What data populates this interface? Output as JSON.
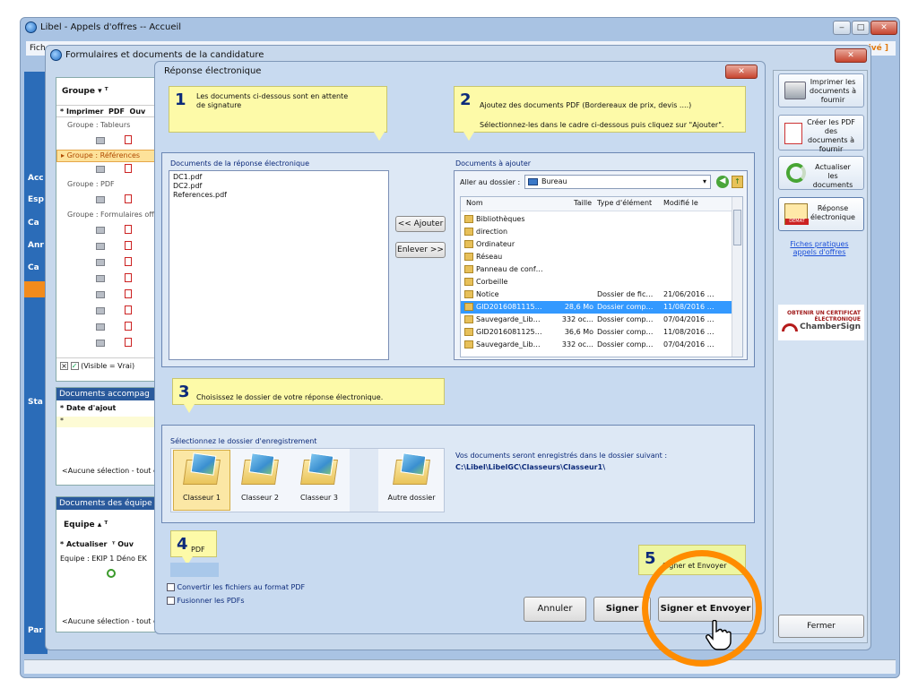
{
  "main_window": {
    "title": "Libel - Appels d'offres -- Accueil",
    "menu_first": "Fich",
    "right_tag": "ivé ]"
  },
  "app_controls": {
    "minimize": "‒",
    "maximize": "□",
    "close": "✕"
  },
  "left_nav": {
    "items": [
      "Acc",
      "Esp",
      "Ca",
      "Anr",
      "Ca",
      "Sta",
      "Par"
    ]
  },
  "candidature_window": {
    "title": "Formulaires et documents de la candidature",
    "groupe_header": "Groupe",
    "toolbar": {
      "imprimer": "Imprimer",
      "pdf": "PDF",
      "ouv": "Ouv"
    },
    "groups": [
      "Groupe : Tableurs",
      "Groupe : Références",
      "Groupe : PDF",
      "Groupe : Formulaires off"
    ],
    "filter_label": "(Visible = Vrai)",
    "docs_accomp": {
      "title": "Documents accompag",
      "date_col": "Date d'ajout",
      "empty": "<Aucune sélection - tout e"
    },
    "docs_equipe": {
      "title": "Documents des équipe",
      "equipe_header": "Equipe",
      "actualiser": "Actualiser",
      "ouv": "Ouv",
      "row": "Equipe : EKIP 1 Déno EK",
      "empty": "<Aucune sélection - tout e"
    },
    "sidebar": {
      "imprimer": "Imprimer les documents à fournir",
      "creer_pdf": "Créer les PDF des documents à fournir",
      "actualiser": "Actualiser les documents",
      "reponse": "Réponse électronique",
      "fiches": "Fiches pratiques appels d'offres",
      "chambersign_top": "OBTENIR UN CERTIFICAT ÉLECTRONIQUE",
      "chambersign_brand": "ChamberSign",
      "fermer": "Fermer",
      "demat": "DÉMAT"
    }
  },
  "dialog": {
    "title": "Réponse électronique",
    "close": "✕",
    "step1": {
      "num": "1",
      "text": "Les documents ci-dessous sont en attente de signature"
    },
    "step2": {
      "num": "2",
      "line1": "Ajoutez des documents PDF (Bordereaux de prix, devis ....)",
      "line2": "Sélectionnez-les dans le cadre  ci-dessous puis cliquez sur \"Ajouter\"."
    },
    "step3": {
      "num": "3",
      "text": "Choisissez le dossier de votre réponse électronique."
    },
    "step4": {
      "num": "4",
      "text": "PDF"
    },
    "step5": {
      "num": "5",
      "text": "Signer et Envoyer"
    },
    "docs_reponse": {
      "label": "Documents de la réponse électronique",
      "files": [
        "DC1.pdf",
        "DC2.pdf",
        "References.pdf"
      ]
    },
    "add_button": "<< Ajouter",
    "remove_button": "Enlever >>",
    "docs_ajouter": {
      "label": "Documents à ajouter",
      "aller_label": "Aller au dossier :",
      "folder": "Bureau",
      "columns": [
        "Nom",
        "Taille",
        "Type d'élément",
        "Modifié le"
      ],
      "rows": [
        {
          "name": "Bibliothèques",
          "size": "",
          "type": "",
          "date": ""
        },
        {
          "name": "direction",
          "size": "",
          "type": "",
          "date": ""
        },
        {
          "name": "Ordinateur",
          "size": "",
          "type": "",
          "date": ""
        },
        {
          "name": "Réseau",
          "size": "",
          "type": "",
          "date": ""
        },
        {
          "name": "Panneau de conf…",
          "size": "",
          "type": "",
          "date": ""
        },
        {
          "name": "Corbeille",
          "size": "",
          "type": "",
          "date": ""
        },
        {
          "name": "Notice",
          "size": "",
          "type": "Dossier de fic…",
          "date": "21/06/2016 …"
        },
        {
          "name": "GID2016081115…",
          "size": "28,6 Mo",
          "type": "Dossier comp…",
          "date": "11/08/2016 …"
        },
        {
          "name": "Sauvegarde_Lib…",
          "size": "332 oc…",
          "type": "Dossier comp…",
          "date": "07/04/2016 …"
        },
        {
          "name": "GID2016081125…",
          "size": "36,6 Mo",
          "type": "Dossier comp…",
          "date": "11/08/2016 …"
        },
        {
          "name": "Sauvegarde_Lib…",
          "size": "332 oc…",
          "type": "Dossier comp…",
          "date": "07/04/2016 …"
        }
      ],
      "selected_row": 7
    },
    "dossier": {
      "label": "Sélectionnez le dossier d'enregistrement",
      "folders": [
        "Classeur 1",
        "Classeur 2",
        "Classeur 3",
        "Autre dossier"
      ],
      "save_info": "Vos documents seront enregistrés dans le dossier suivant :",
      "save_path": "C:\\Libel\\LibelGC\\Classeurs\\Classeur1\\"
    },
    "options": {
      "convert": "Convertir les fichiers au format PDF",
      "merge": "Fusionner les PDFs"
    },
    "buttons": {
      "annuler": "Annuler",
      "signer": "Signer",
      "signer_envoyer": "Signer et Envoyer"
    }
  },
  "colors": {
    "highlight": "#ff8c00",
    "selection": "#3399ff",
    "note": "#fdfaa8",
    "frame": "#c7d8ec"
  }
}
